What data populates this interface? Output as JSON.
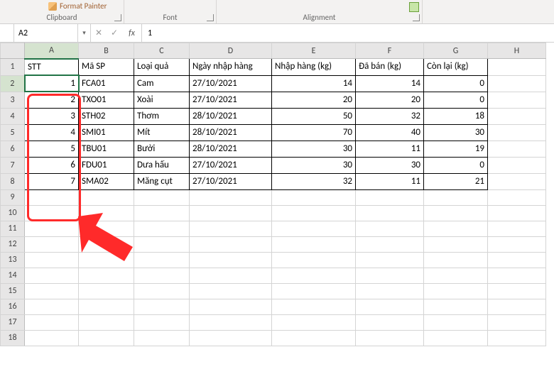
{
  "ribbon": {
    "format_painter": "Format Painter",
    "clipboard": "Clipboard",
    "font": "Font",
    "alignment": "Alignment"
  },
  "namebox": {
    "ref": "A2"
  },
  "formula_bar": {
    "fx": "fx",
    "value": "1"
  },
  "columns": [
    "A",
    "B",
    "C",
    "D",
    "E",
    "F",
    "G",
    "H"
  ],
  "col_classes": [
    "col-A",
    "col-B",
    "col-C",
    "col-D",
    "col-E",
    "col-F",
    "col-G",
    "col-H"
  ],
  "selected_col": 0,
  "selected_row_1based": 2,
  "headers": [
    "STT",
    "Mã SP",
    "Loại quả",
    "Ngày nhập hàng",
    "Nhập hàng (kg)",
    "Đã bán (kg)",
    "Còn lại (kg)"
  ],
  "rows": [
    {
      "stt": 1,
      "ma": "FCA01",
      "loai": "Cam",
      "ngay": "27/10/2021",
      "nhap": 14,
      "ban": 14,
      "con": 0
    },
    {
      "stt": 2,
      "ma": "TXO01",
      "loai": "Xoài",
      "ngay": "27/10/2021",
      "nhap": 20,
      "ban": 20,
      "con": 0
    },
    {
      "stt": 3,
      "ma": "STH02",
      "loai": "Thơm",
      "ngay": "28/10/2021",
      "nhap": 50,
      "ban": 32,
      "con": 18
    },
    {
      "stt": 4,
      "ma": "SMI01",
      "loai": "Mít",
      "ngay": "28/10/2021",
      "nhap": 70,
      "ban": 40,
      "con": 30
    },
    {
      "stt": 5,
      "ma": "TBU01",
      "loai": "Bưởi",
      "ngay": "28/10/2021",
      "nhap": 30,
      "ban": 11,
      "con": 19
    },
    {
      "stt": 6,
      "ma": "FDU01",
      "loai": "Dưa hấu",
      "ngay": "27/10/2021",
      "nhap": 30,
      "ban": 30,
      "con": 0
    },
    {
      "stt": 7,
      "ma": "SMA02",
      "loai": "Măng cụt",
      "ngay": "27/10/2021",
      "nhap": 32,
      "ban": 11,
      "con": 21
    }
  ],
  "blank_rows_after": 10,
  "chart_data": {
    "type": "table",
    "title": "",
    "columns": [
      "STT",
      "Mã SP",
      "Loại quả",
      "Ngày nhập hàng",
      "Nhập hàng (kg)",
      "Đã bán (kg)",
      "Còn lại (kg)"
    ],
    "data": [
      [
        1,
        "FCA01",
        "Cam",
        "27/10/2021",
        14,
        14,
        0
      ],
      [
        2,
        "TXO01",
        "Xoài",
        "27/10/2021",
        20,
        20,
        0
      ],
      [
        3,
        "STH02",
        "Thơm",
        "28/10/2021",
        50,
        32,
        18
      ],
      [
        4,
        "SMI01",
        "Mít",
        "28/10/2021",
        70,
        40,
        30
      ],
      [
        5,
        "TBU01",
        "Bưởi",
        "28/10/2021",
        30,
        11,
        19
      ],
      [
        6,
        "FDU01",
        "Dưa hấu",
        "27/10/2021",
        30,
        30,
        0
      ],
      [
        7,
        "SMA02",
        "Măng cụt",
        "27/10/2021",
        32,
        11,
        21
      ]
    ]
  }
}
